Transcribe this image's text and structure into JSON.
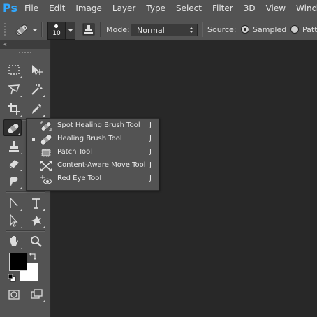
{
  "app": {
    "logo": "Ps"
  },
  "menubar": {
    "items": [
      "File",
      "Edit",
      "Image",
      "Layer",
      "Type",
      "Select",
      "Filter",
      "3D",
      "View",
      "Windo"
    ]
  },
  "options": {
    "brush_size": "10",
    "mode_label": "Mode:",
    "mode_value": "Normal",
    "source_label": "Source:",
    "source_options": [
      "Sampled",
      "Patte"
    ],
    "source_selected": "Sampled"
  },
  "toolbox": {
    "collapse_glyph": "«",
    "foreground_color": "#000000",
    "background_color": "#ffffff"
  },
  "flyout": {
    "items": [
      {
        "label": "Spot Healing Brush Tool",
        "shortcut": "J",
        "selected": false,
        "icon": "spot-healing-brush-icon"
      },
      {
        "label": "Healing Brush Tool",
        "shortcut": "J",
        "selected": true,
        "icon": "healing-brush-icon"
      },
      {
        "label": "Patch Tool",
        "shortcut": "J",
        "selected": false,
        "icon": "patch-icon"
      },
      {
        "label": "Content-Aware Move Tool",
        "shortcut": "J",
        "selected": false,
        "icon": "content-aware-move-icon"
      },
      {
        "label": "Red Eye Tool",
        "shortcut": "J",
        "selected": false,
        "icon": "red-eye-icon"
      }
    ]
  }
}
